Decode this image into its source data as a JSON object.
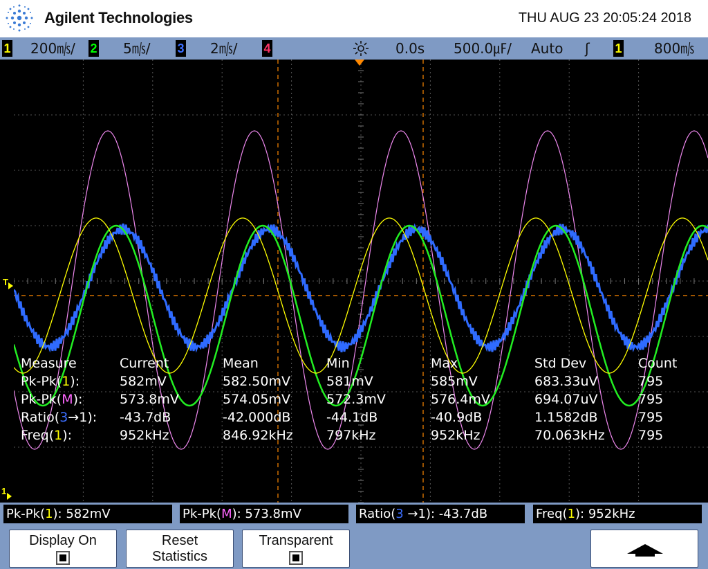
{
  "header": {
    "brand": "Agilent Technologies",
    "datetime": "THU AUG 23 20:05:24 2018",
    "logo_icon": "agilent-spark-icon"
  },
  "settings": {
    "channels": [
      {
        "num": "1",
        "scale": "200㎧/",
        "color": "#ffff00"
      },
      {
        "num": "2",
        "scale": "5㎧/",
        "color": "#00ff00"
      },
      {
        "num": "3",
        "scale": "2㎧/",
        "color": "#3b6eff"
      },
      {
        "num": "4",
        "scale": "",
        "color": "#ff3366"
      }
    ],
    "run_icon": "run-status-icon",
    "delay": "0.0s",
    "timebase": "500.0㎌/",
    "trigger_mode": "Auto",
    "trigger_slope": "ʃ",
    "trigger_source": "1",
    "trigger_level": "800㎧"
  },
  "markers": {
    "trigger": "T",
    "ground": "1"
  },
  "measurements": {
    "headers": [
      "Measure",
      "Current",
      "Mean",
      "Min",
      "Max",
      "Std Dev",
      "Count"
    ],
    "rows": [
      {
        "label_pre": "Pk-Pk(",
        "label_src": "1",
        "label_src_color": "#ffff00",
        "label_post": "):",
        "current": "582mV",
        "mean": "582.50mV",
        "min": "581mV",
        "max": "585mV",
        "std": "683.33uV",
        "count": "795"
      },
      {
        "label_pre": "Pk-Pk(",
        "label_src": "M",
        "label_src_color": "#ff66ff",
        "label_post": "):",
        "current": "573.8mV",
        "mean": "574.05mV",
        "min": "572.3mV",
        "max": "576.4mV",
        "std": "694.07uV",
        "count": "795"
      },
      {
        "label_pre": "Ratio(",
        "label_src": "3",
        "label_src2": "→1",
        "label_src_color": "#3b6eff",
        "label_post": "):",
        "current": "-43.7dB",
        "mean": "-42.000dB",
        "min": "-44.1dB",
        "max": "-40.9dB",
        "std": "1.1582dB",
        "count": "795"
      },
      {
        "label_pre": "Freq(",
        "label_src": "1",
        "label_src_color": "#ffff00",
        "label_post": "):",
        "current": "952kHz",
        "mean": "846.92kHz",
        "min": "797kHz",
        "max": "952kHz",
        "std": "70.063kHz",
        "count": "795"
      }
    ]
  },
  "readouts": [
    {
      "pre": "Pk-Pk(",
      "src": "1",
      "src_color": "#ffff00",
      "post": "): 582mV"
    },
    {
      "pre": "Pk-Pk(",
      "src": "M",
      "src_color": "#ff66ff",
      "post": "): 573.8mV"
    },
    {
      "pre": "Ratio(",
      "src": "3",
      "src2": " →1",
      "src_color": "#3b6eff",
      "post": "): -43.7dB"
    },
    {
      "pre": "Freq(",
      "src": "1",
      "src_color": "#ffff00",
      "post": "): 952kHz"
    }
  ],
  "softkeys": {
    "display_on": {
      "line1": "Display On"
    },
    "reset": {
      "line1": "Reset",
      "line2": "Statistics"
    },
    "transparent": {
      "line1": "Transparent"
    },
    "arrow_icon": "up-arrow-icon"
  },
  "colors": {
    "ch1": "#ffff00",
    "ch2": "#22ee22",
    "ch3": "#2f6bff",
    "math": "#ee88ee",
    "grid": "#555555",
    "cursor": "#ff8800",
    "bar": "#7f9ac4"
  }
}
